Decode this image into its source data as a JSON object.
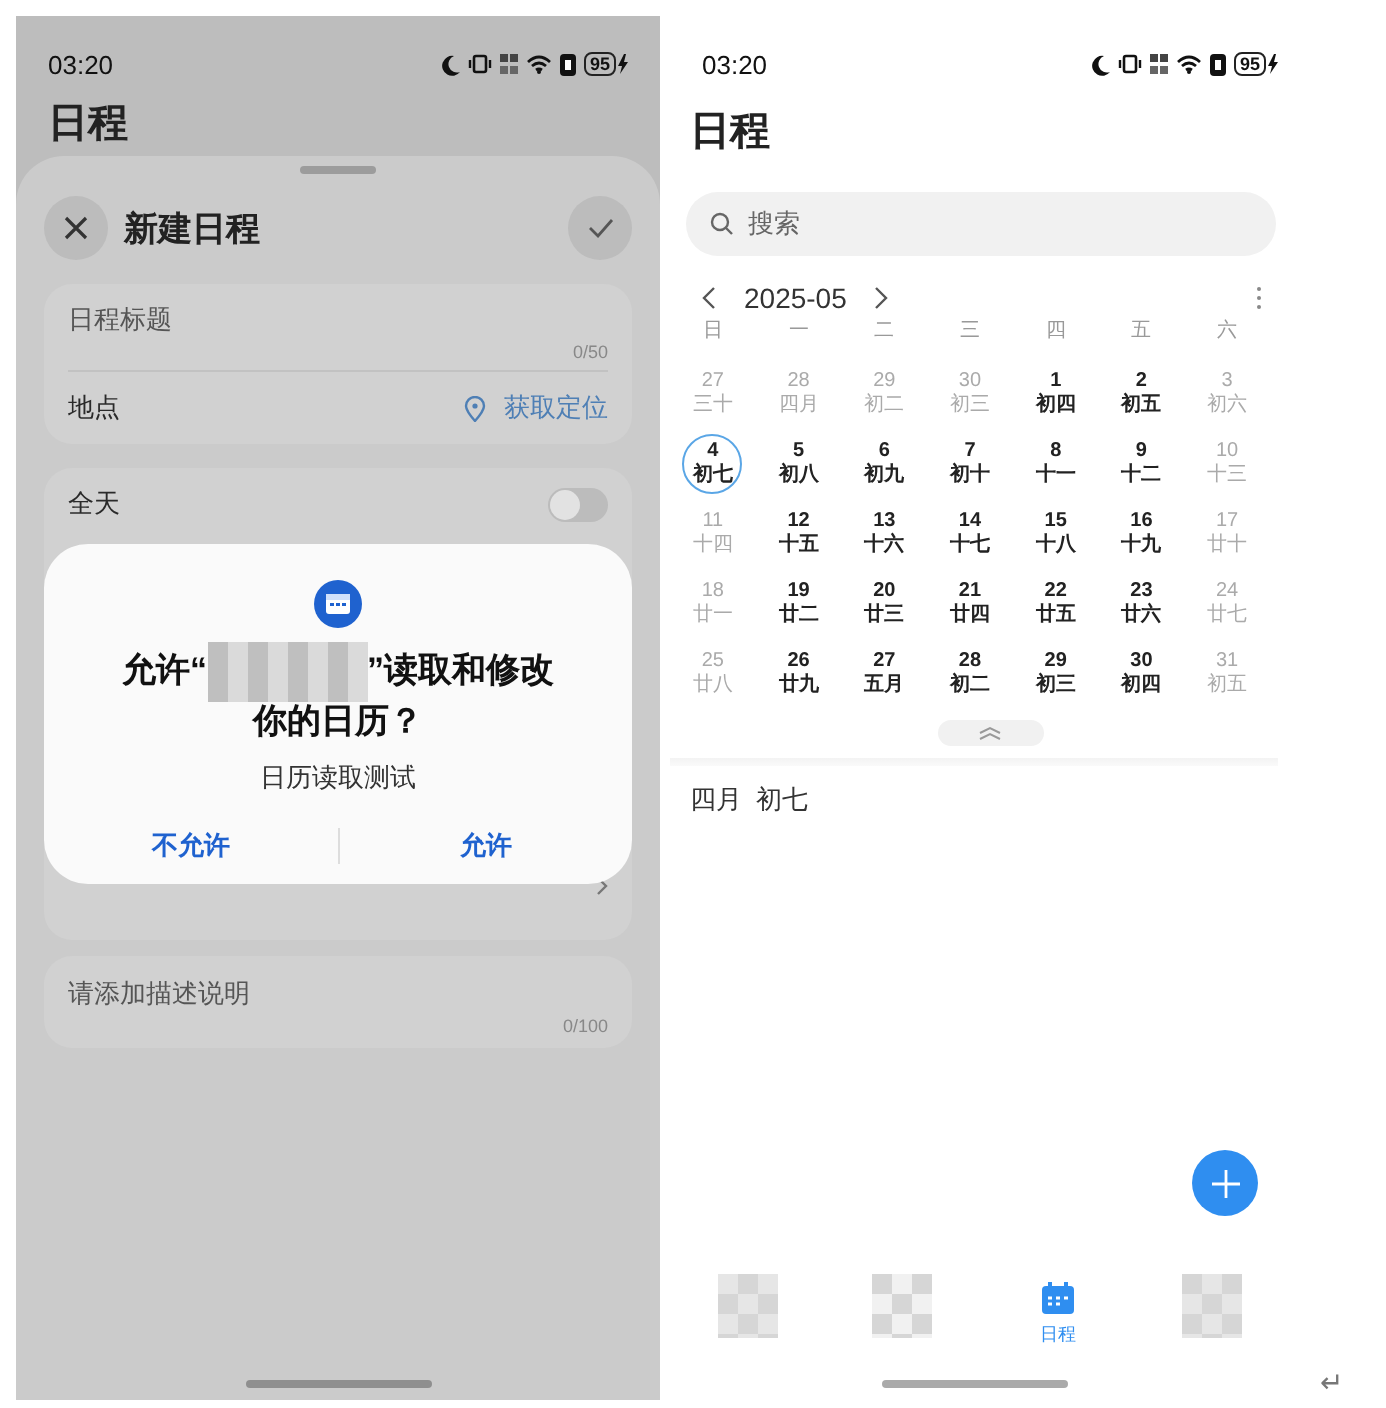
{
  "left_phone": {
    "status_bar": {
      "time": "03:20",
      "battery": "95"
    },
    "page_title": "日程",
    "sheet": {
      "title": "新建日程",
      "title_field": {
        "placeholder": "日程标题",
        "counter": "0/50"
      },
      "location": {
        "label": "地点",
        "action": "获取定位"
      },
      "all_day": {
        "label": "全天",
        "on": false
      },
      "description": {
        "placeholder": "请添加描述说明",
        "counter": "0/100"
      }
    },
    "dialog": {
      "title_before": "允许“",
      "title_after": "”读取和修改",
      "title_line_2": "你的日历？",
      "subtitle": "日历读取测试",
      "buttons": [
        "不允许",
        "允许"
      ]
    }
  },
  "right_phone": {
    "status_bar": {
      "time": "03:20",
      "battery": "95"
    },
    "page_title": "日程",
    "search": {
      "placeholder": "搜索"
    },
    "month": "2025-05",
    "weekdays": [
      "日",
      "一",
      "二",
      "三",
      "四",
      "五",
      "六"
    ],
    "weeks": [
      [
        {
          "day": "27",
          "lunar": "三十",
          "muted": true,
          "selected": false
        },
        {
          "day": "28",
          "lunar": "四月",
          "muted": true,
          "selected": false
        },
        {
          "day": "29",
          "lunar": "初二",
          "muted": true,
          "selected": false
        },
        {
          "day": "30",
          "lunar": "初三",
          "muted": true,
          "selected": false
        },
        {
          "day": "1",
          "lunar": "初四",
          "muted": false,
          "selected": false
        },
        {
          "day": "2",
          "lunar": "初五",
          "muted": false,
          "selected": false
        },
        {
          "day": "3",
          "lunar": "初六",
          "muted": true,
          "selected": false
        }
      ],
      [
        {
          "day": "4",
          "lunar": "初七",
          "muted": false,
          "selected": true
        },
        {
          "day": "5",
          "lunar": "初八",
          "muted": false,
          "selected": false
        },
        {
          "day": "6",
          "lunar": "初九",
          "muted": false,
          "selected": false
        },
        {
          "day": "7",
          "lunar": "初十",
          "muted": false,
          "selected": false
        },
        {
          "day": "8",
          "lunar": "十一",
          "muted": false,
          "selected": false
        },
        {
          "day": "9",
          "lunar": "十二",
          "muted": false,
          "selected": false
        },
        {
          "day": "10",
          "lunar": "十三",
          "muted": true,
          "selected": false
        }
      ],
      [
        {
          "day": "11",
          "lunar": "十四",
          "muted": true,
          "selected": false
        },
        {
          "day": "12",
          "lunar": "十五",
          "muted": false,
          "selected": false
        },
        {
          "day": "13",
          "lunar": "十六",
          "muted": false,
          "selected": false
        },
        {
          "day": "14",
          "lunar": "十七",
          "muted": false,
          "selected": false
        },
        {
          "day": "15",
          "lunar": "十八",
          "muted": false,
          "selected": false
        },
        {
          "day": "16",
          "lunar": "十九",
          "muted": false,
          "selected": false
        },
        {
          "day": "17",
          "lunar": "廿十",
          "muted": true,
          "selected": false
        }
      ],
      [
        {
          "day": "18",
          "lunar": "廿一",
          "muted": true,
          "selected": false
        },
        {
          "day": "19",
          "lunar": "廿二",
          "muted": false,
          "selected": false
        },
        {
          "day": "20",
          "lunar": "廿三",
          "muted": false,
          "selected": false
        },
        {
          "day": "21",
          "lunar": "廿四",
          "muted": false,
          "selected": false
        },
        {
          "day": "22",
          "lunar": "廿五",
          "muted": false,
          "selected": false
        },
        {
          "day": "23",
          "lunar": "廿六",
          "muted": false,
          "selected": false
        },
        {
          "day": "24",
          "lunar": "廿七",
          "muted": true,
          "selected": false
        }
      ],
      [
        {
          "day": "25",
          "lunar": "廿八",
          "muted": true,
          "selected": false
        },
        {
          "day": "26",
          "lunar": "廿九",
          "muted": false,
          "selected": false
        },
        {
          "day": "27",
          "lunar": "五月",
          "muted": false,
          "selected": false
        },
        {
          "day": "28",
          "lunar": "初二",
          "muted": false,
          "selected": false
        },
        {
          "day": "29",
          "lunar": "初三",
          "muted": false,
          "selected": false
        },
        {
          "day": "30",
          "lunar": "初四",
          "muted": false,
          "selected": false
        },
        {
          "day": "31",
          "lunar": "初五",
          "muted": true,
          "selected": false
        }
      ]
    ],
    "selected_date": "四月  初七",
    "tabs": [
      {
        "kind": "redacted",
        "selected": false
      },
      {
        "kind": "redacted",
        "selected": false
      },
      {
        "kind": "calendar",
        "label": "日程",
        "selected": true
      },
      {
        "kind": "redacted",
        "selected": false
      }
    ]
  },
  "return_symbol": "↵"
}
